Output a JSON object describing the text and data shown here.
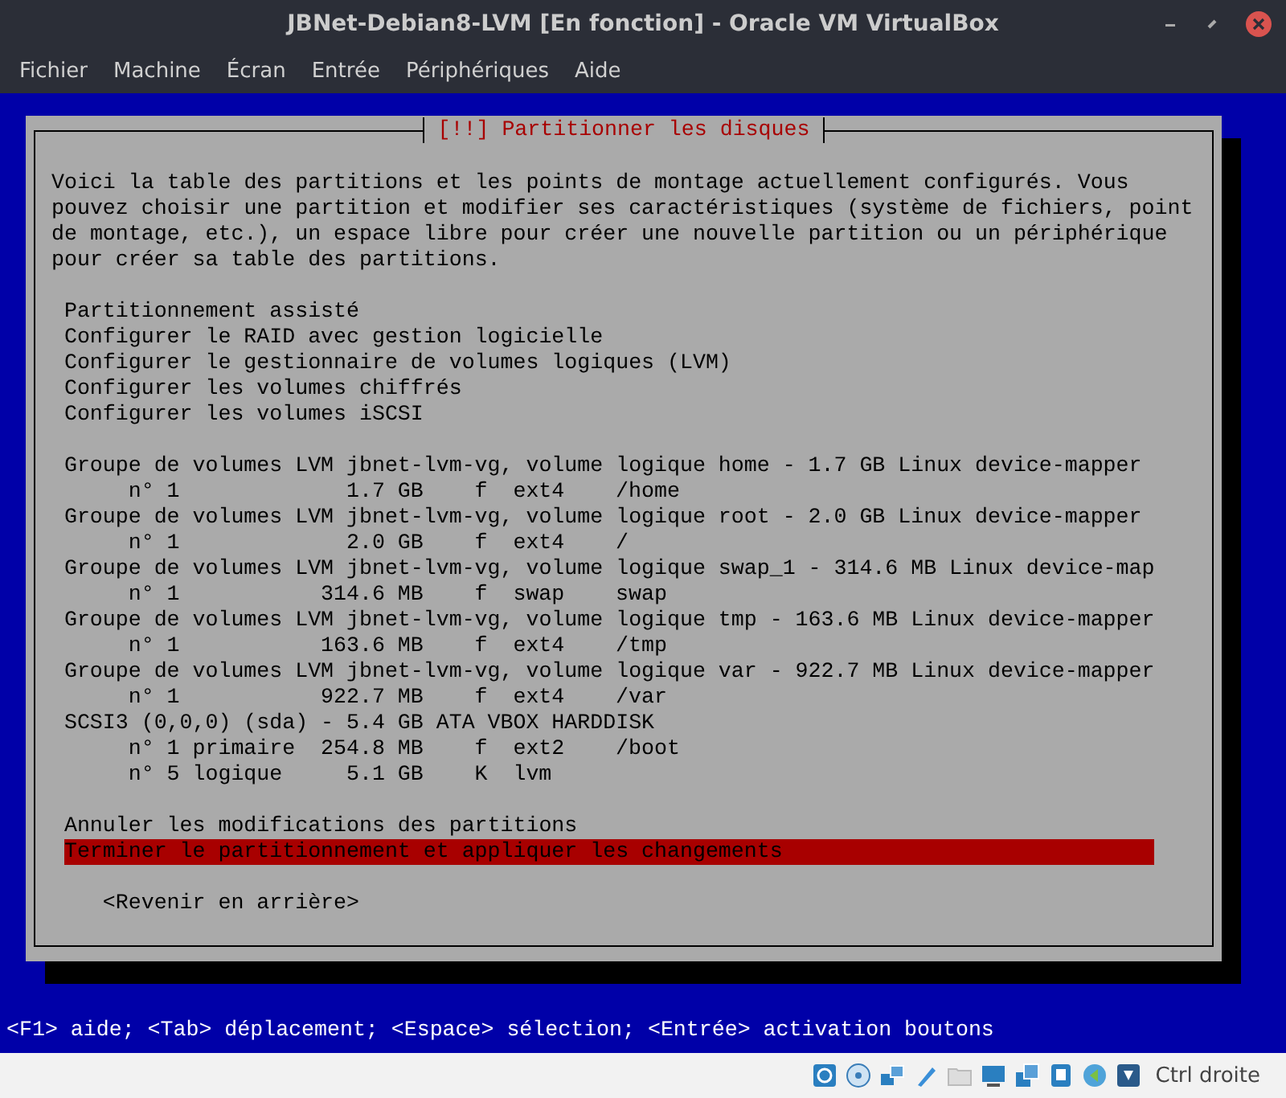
{
  "window": {
    "title": "JBNet-Debian8-LVM [En fonction] - Oracle VM VirtualBox"
  },
  "menu": [
    "Fichier",
    "Machine",
    "Écran",
    "Entrée",
    "Périphériques",
    "Aide"
  ],
  "dialog": {
    "title": "[!!] Partitionner les disques",
    "intro": "Voici la table des partitions et les points de montage actuellement configurés. Vous pouvez choisir une partition et modifier ses caractéristiques (système de fichiers, point de montage, etc.), un espace libre pour créer une nouvelle partition ou un périphérique pour créer sa table des partitions.",
    "groups": [
      {
        "items": [
          {
            "kind": "action",
            "label": "Partitionnement assisté",
            "selected": false
          },
          {
            "kind": "action",
            "label": "Configurer le RAID avec gestion logicielle",
            "selected": false
          },
          {
            "kind": "action",
            "label": "Configurer le gestionnaire de volumes logiques (LVM)",
            "selected": false
          },
          {
            "kind": "action",
            "label": "Configurer les volumes chiffrés",
            "selected": false
          },
          {
            "kind": "action",
            "label": "Configurer les volumes iSCSI",
            "selected": false
          }
        ]
      },
      {
        "items": [
          {
            "kind": "device",
            "label": "Groupe de volumes LVM jbnet-lvm-vg, volume logique home - 1.7 GB Linux device-mapper",
            "selected": false
          },
          {
            "kind": "partition",
            "number": "n° 1",
            "size": "1.7 GB",
            "flag": "f",
            "fs": "ext4",
            "mount": "/home",
            "selected": false
          },
          {
            "kind": "device",
            "label": "Groupe de volumes LVM jbnet-lvm-vg, volume logique root - 2.0 GB Linux device-mapper",
            "selected": false
          },
          {
            "kind": "partition",
            "number": "n° 1",
            "size": "2.0 GB",
            "flag": "f",
            "fs": "ext4",
            "mount": "/",
            "selected": false
          },
          {
            "kind": "device",
            "label": "Groupe de volumes LVM jbnet-lvm-vg, volume logique swap_1 - 314.6 MB Linux device-map",
            "selected": false
          },
          {
            "kind": "partition",
            "number": "n° 1",
            "size": "314.6 MB",
            "flag": "f",
            "fs": "swap",
            "mount": "swap",
            "selected": false
          },
          {
            "kind": "device",
            "label": "Groupe de volumes LVM jbnet-lvm-vg, volume logique tmp - 163.6 MB Linux device-mapper",
            "selected": false
          },
          {
            "kind": "partition",
            "number": "n° 1",
            "size": "163.6 MB",
            "flag": "f",
            "fs": "ext4",
            "mount": "/tmp",
            "selected": false
          },
          {
            "kind": "device",
            "label": "Groupe de volumes LVM jbnet-lvm-vg, volume logique var - 922.7 MB Linux device-mapper",
            "selected": false
          },
          {
            "kind": "partition",
            "number": "n° 1",
            "size": "922.7 MB",
            "flag": "f",
            "fs": "ext4",
            "mount": "/var",
            "selected": false
          },
          {
            "kind": "device",
            "label": "SCSI3 (0,0,0) (sda) - 5.4 GB ATA VBOX HARDDISK",
            "selected": false
          },
          {
            "kind": "partition",
            "number": "n° 1",
            "type": "primaire",
            "size": "254.8 MB",
            "flag": "f",
            "fs": "ext2",
            "mount": "/boot",
            "selected": false
          },
          {
            "kind": "partition",
            "number": "n° 5",
            "type": "logique",
            "size": "5.1 GB",
            "flag": "K",
            "fs": "lvm",
            "selected": false
          }
        ]
      },
      {
        "items": [
          {
            "kind": "action",
            "label": "Annuler les modifications des partitions",
            "selected": false
          },
          {
            "kind": "action",
            "label": "Terminer le partitionnement et appliquer les changements",
            "selected": true
          }
        ]
      }
    ],
    "back_button": "<Revenir en arrière>"
  },
  "help_line": "<F1> aide; <Tab> déplacement; <Espace> sélection; <Entrée> activation boutons",
  "status_bar": {
    "host_key": "Ctrl droite"
  }
}
